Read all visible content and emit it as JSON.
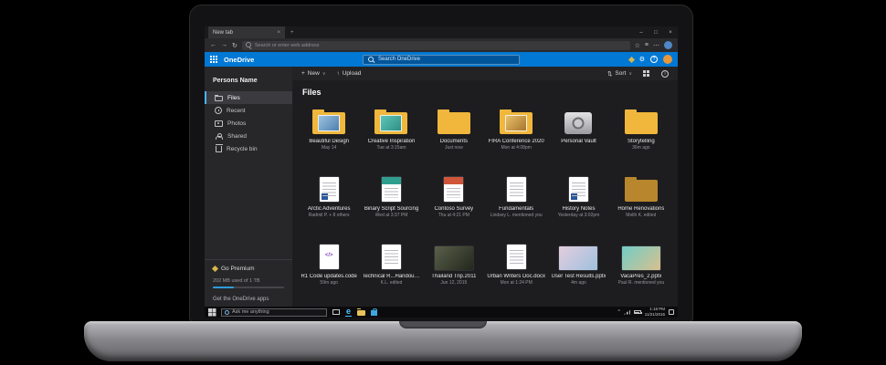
{
  "browser": {
    "tab_title": "New tab",
    "address_placeholder": "Search or enter web address"
  },
  "icons": {
    "plus": "+",
    "close": "×",
    "minimize": "–",
    "maximize": "□",
    "back": "←",
    "forward": "→",
    "refresh": "↻",
    "star": "☆",
    "hub": "≡",
    "more": "⋯",
    "upload": "↑",
    "sort": "⇅",
    "chevron": "∨",
    "chevron_up": "^",
    "gear": "⚙",
    "help": "?",
    "info": "i",
    "edge": "e"
  },
  "onedrive": {
    "app_title": "OneDrive",
    "search_placeholder": "Search OneDrive",
    "accent_color": "#0078d4",
    "sidebar": {
      "user": "Persons Name",
      "items": [
        {
          "label": "Files",
          "icon": "folder",
          "selected": true
        },
        {
          "label": "Recent",
          "icon": "clock",
          "selected": false
        },
        {
          "label": "Photos",
          "icon": "photos",
          "selected": false
        },
        {
          "label": "Shared",
          "icon": "people",
          "selected": false
        },
        {
          "label": "Recycle bin",
          "icon": "bin",
          "selected": false
        }
      ],
      "premium_label": "Go Premium",
      "storage_text": "202 MB used of 1 TB",
      "apps_link": "Get the OneDrive apps"
    },
    "toolbar": {
      "new_label": "New",
      "upload_label": "Upload",
      "sort_label": "Sort"
    },
    "section_title": "Files",
    "files": [
      {
        "name": "Beautiful Design",
        "meta": "May 14",
        "kind": "folder-photo",
        "c1": "#9ec4e0",
        "c2": "#4e7fae"
      },
      {
        "name": "Creative Inspiration",
        "meta": "Tue at 3:15am",
        "kind": "folder-photo",
        "c1": "#5fc6b8",
        "c2": "#2e8f83"
      },
      {
        "name": "Documents",
        "meta": "Just now",
        "kind": "folder"
      },
      {
        "name": "FIRA Conference 2020",
        "meta": "Mon at 4:08pm",
        "kind": "folder-photo",
        "c1": "#e8c26a",
        "c2": "#a8742e"
      },
      {
        "name": "Personal Vault",
        "meta": "",
        "kind": "vault"
      },
      {
        "name": "Storytelling",
        "meta": "36m ago",
        "kind": "folder"
      },
      {
        "name": "Arctic Adventures",
        "meta": "Radmil P. + 8 others",
        "kind": "word"
      },
      {
        "name": "Binary Script Sourcing",
        "meta": "Wed at 3:37 PM",
        "kind": "banner",
        "c1": "#2f9e8f"
      },
      {
        "name": "Contoso Survey",
        "meta": "Thu at 4:21 PM",
        "kind": "banner",
        "c1": "#d0563a"
      },
      {
        "name": "Fundamentals",
        "meta": "Lindsey L. mentioned you",
        "kind": "doc"
      },
      {
        "name": "History Notes",
        "meta": "Yesterday at 3:02pm",
        "kind": "word"
      },
      {
        "name": "Home Renovations",
        "meta": "Melih K. edited",
        "kind": "folder",
        "c1": "#b8862c"
      },
      {
        "name": "R1 Code updates.code",
        "meta": "59m ago",
        "kind": "code"
      },
      {
        "name": "Technical R...Handout.pptx",
        "meta": "K.L. edited",
        "kind": "doc"
      },
      {
        "name": "Thailand Trip.2011",
        "meta": "Jun 12, 2015",
        "kind": "photo",
        "c1": "#59604a",
        "c2": "#23271d"
      },
      {
        "name": "Urban Writers Doc.docx",
        "meta": "Mon at 1:24 PM",
        "kind": "doc"
      },
      {
        "name": "User Test Results.pptx",
        "meta": "4m ago",
        "kind": "photo",
        "c1": "#e3cede",
        "c2": "#9fc0dd"
      },
      {
        "name": "VacaPres_2.pptx",
        "meta": "Paul R. mentioned you",
        "kind": "photo",
        "c1": "#72cdc6",
        "c2": "#d8c08e"
      }
    ]
  },
  "taskbar": {
    "search_placeholder": "Ask me anything",
    "time": "1:18 PM",
    "date": "11/21/2016"
  }
}
